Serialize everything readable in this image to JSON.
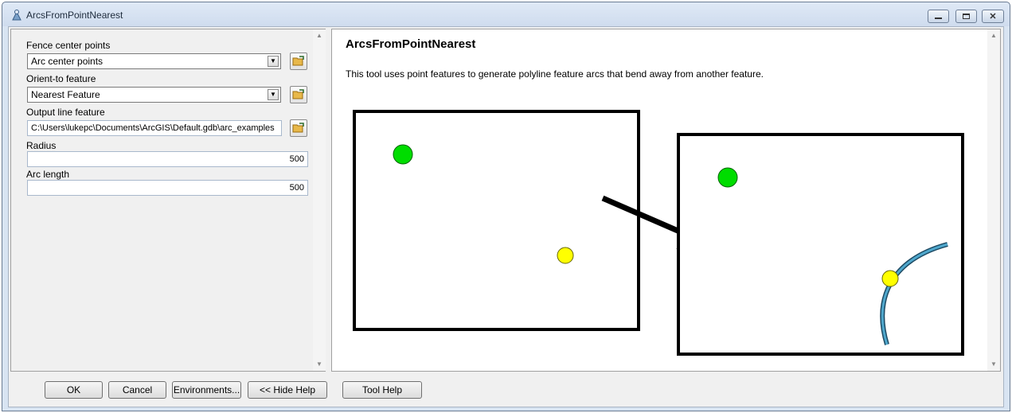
{
  "window": {
    "title": "ArcsFromPointNearest",
    "app_icon": "geoprocessing-tool-icon",
    "controls": {
      "minimize": "minimize-icon",
      "maximize": "maximize-icon",
      "close": "close-icon"
    }
  },
  "params": {
    "fence_center": {
      "label": "Fence center points",
      "value": "Arc center points",
      "browse_icon": "open-folder-icon"
    },
    "orient_to": {
      "label": "Orient-to feature",
      "value": "Nearest Feature",
      "browse_icon": "open-folder-icon"
    },
    "output_line": {
      "label": "Output line feature",
      "value": "C:\\Users\\lukepc\\Documents\\ArcGIS\\Default.gdb\\arc_examples",
      "browse_icon": "open-folder-icon"
    },
    "radius": {
      "label": "Radius",
      "value": "500"
    },
    "arc_length": {
      "label": "Arc length",
      "value": "500"
    }
  },
  "help": {
    "title": "ArcsFromPointNearest",
    "description": "This tool uses point features to generate polyline feature arcs that bend away from another feature.",
    "illustration": {
      "colors": {
        "fence_point": "#00dd00",
        "orient_point": "#ffff00",
        "arc": "#3a8fb3",
        "frame": "#000000"
      }
    }
  },
  "buttons": {
    "ok": "OK",
    "cancel": "Cancel",
    "environments": "Environments...",
    "hide_help": "<< Hide Help",
    "tool_help": "Tool Help"
  }
}
